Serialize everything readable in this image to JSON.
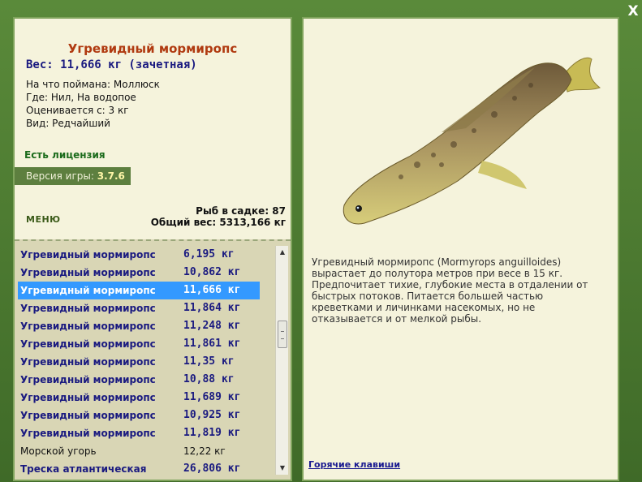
{
  "window": {
    "close_label": "X"
  },
  "fish": {
    "title": "Угревидный мормиропс",
    "weight_line": "Вес: 11,666 кг (зачетная)",
    "caught_on": "На что поймана: Моллюск",
    "where": "Где: Нил, На водопое",
    "valued_from": "Оценивается с: 3 кг",
    "kind": "Вид: Редчайший",
    "description": "Угревидный мормиропс (Mormyrops anguilloides) вырастает до полутора метров при весе в 15 кг. Предпочитает тихие, глубокие места в отдалении от быстрых потоков. Питается большей частью креветками и личинками насекомых, но не отказывается и от мелкой рыбы."
  },
  "license": "Есть лицензия",
  "version": {
    "label": "Версия игры:",
    "value": "3.7.6"
  },
  "menu_label": "МЕНЮ",
  "keep": {
    "count_line": "Рыб в садке: 87",
    "total_line": "Общий вес: 5313,166 кг"
  },
  "catch_list": [
    {
      "name": "Угревидный мормиропс",
      "weight": "6,195 кг"
    },
    {
      "name": "Угревидный мормиропс",
      "weight": "10,862 кг"
    },
    {
      "name": "Угревидный мормиропс",
      "weight": "11,666 кг",
      "selected": true
    },
    {
      "name": "Угревидный мормиропс",
      "weight": "11,864 кг"
    },
    {
      "name": "Угревидный мормиропс",
      "weight": "11,248 кг"
    },
    {
      "name": "Угревидный мормиропс",
      "weight": "11,861 кг"
    },
    {
      "name": "Угревидный мормиропс",
      "weight": "11,35 кг"
    },
    {
      "name": "Угревидный мормиропс",
      "weight": "10,88 кг"
    },
    {
      "name": "Угревидный мормиропс",
      "weight": "11,689 кг"
    },
    {
      "name": "Угревидный мормиропс",
      "weight": "10,925 кг"
    },
    {
      "name": "Угревидный мормиропс",
      "weight": "11,819 кг"
    },
    {
      "name": "Морской угорь",
      "weight": "12,22 кг",
      "other": true
    },
    {
      "name": "Треска атлантическая",
      "weight": "26,806 кг"
    }
  ],
  "hotkeys_label": "Горячие клавиши",
  "colors": {
    "frame": "#4e7a32",
    "panel": "#f5f3dc",
    "selected": "#3399ff",
    "fish_name": "#b03a10"
  }
}
